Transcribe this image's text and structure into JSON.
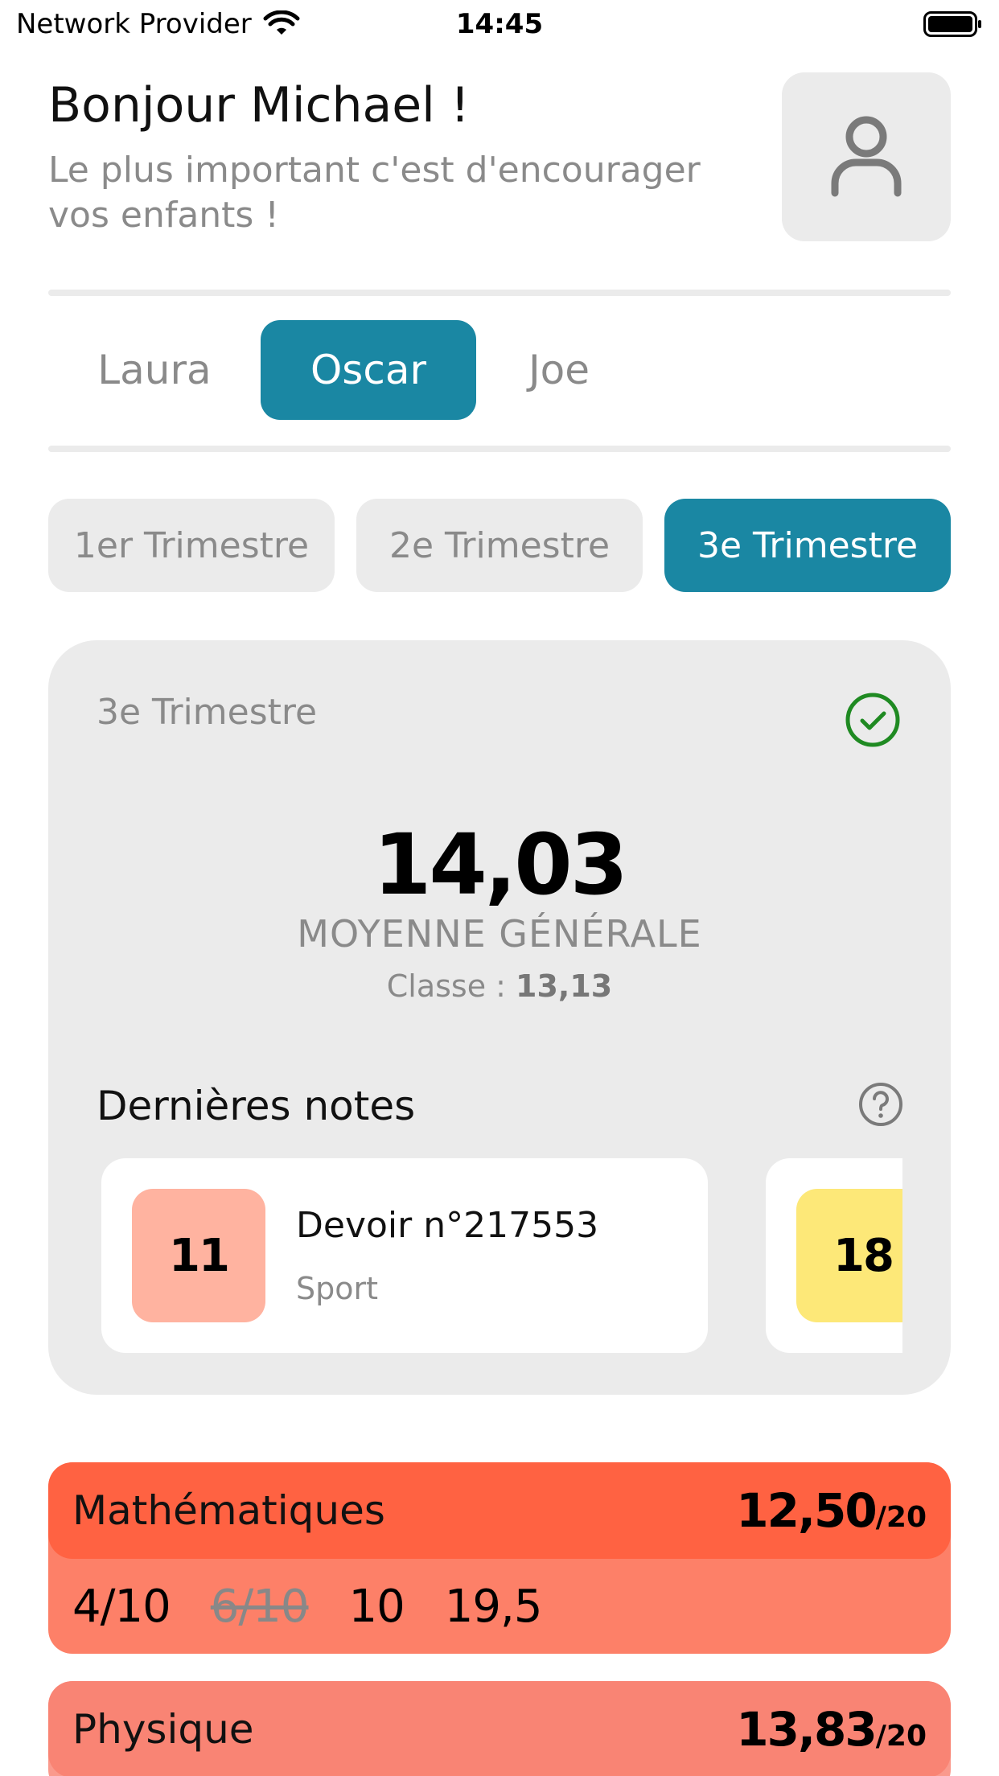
{
  "status_bar": {
    "carrier": "Network Provider",
    "time": "14:45",
    "wifi_icon": "wifi-icon",
    "battery_icon": "battery-icon"
  },
  "header": {
    "greeting": "Bonjour Michael !",
    "subtitle": "Le plus important c'est d'encourager vos enfants !",
    "avatar_icon": "user-icon"
  },
  "children": {
    "items": [
      "Laura",
      "Oscar",
      "Joe"
    ],
    "selected": "Oscar"
  },
  "trimesters": {
    "items": [
      "1er Trimestre",
      "2e Trimestre",
      "3e Trimestre"
    ],
    "selected": "3e Trimestre"
  },
  "summary": {
    "title": "3e Trimestre",
    "status_icon": "check-circle-icon",
    "average": "14,03",
    "average_label": "MOYENNE GÉNÉRALE",
    "class_prefix": "Classe : ",
    "class_average": "13,13",
    "recent_title": "Dernières notes",
    "help_icon": "question-circle-icon",
    "recent_notes": [
      {
        "grade": "11",
        "title": "Devoir n°217553",
        "subject": "Sport",
        "color": "#ffb3a0"
      },
      {
        "grade": "18",
        "title": "",
        "subject": "",
        "color": "#fde878"
      }
    ]
  },
  "subjects": [
    {
      "name": "Mathématiques",
      "average": "12,50",
      "scale": "/20",
      "header_color": "#ff6242",
      "body_color": "#fd8068",
      "grades": [
        {
          "value": "4/10",
          "struck": false
        },
        {
          "value": "6/10",
          "struck": true
        },
        {
          "value": "10",
          "struck": false
        },
        {
          "value": "19,5",
          "struck": false
        }
      ]
    },
    {
      "name": "Physique",
      "average": "13,83",
      "scale": "/20",
      "header_color": "#f98474",
      "body_color": "#fa9a8d",
      "grades": []
    }
  ],
  "colors": {
    "accent": "#1a87a3",
    "surface": "#ebebeb",
    "success": "#1f8a22"
  }
}
